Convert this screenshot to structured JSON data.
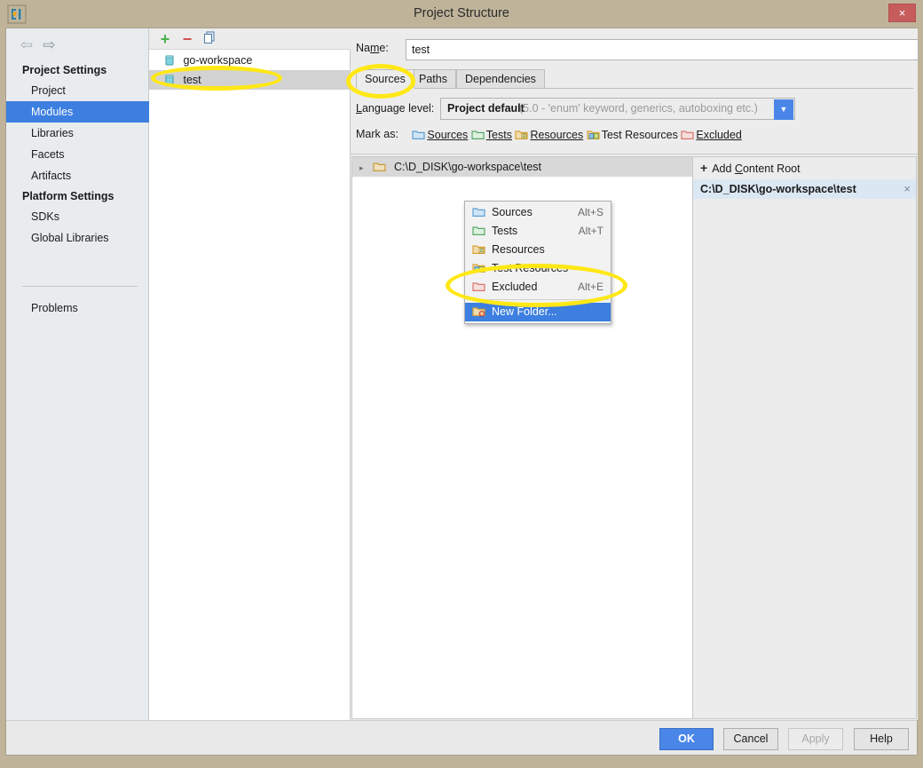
{
  "window": {
    "title": "Project Structure",
    "app_icon": "intellij-idea-logo",
    "close_label": "×"
  },
  "nav": {
    "back_icon": "arrow-left-icon",
    "forward_icon": "arrow-right-icon",
    "back_glyph": "⇦",
    "forward_glyph": "⇨"
  },
  "sidebar": {
    "groups": [
      {
        "label": "Project Settings",
        "items": [
          {
            "label": "Project",
            "selected": false
          },
          {
            "label": "Modules",
            "selected": true
          },
          {
            "label": "Libraries",
            "selected": false
          },
          {
            "label": "Facets",
            "selected": false
          },
          {
            "label": "Artifacts",
            "selected": false
          }
        ]
      },
      {
        "label": "Platform Settings",
        "items": [
          {
            "label": "SDKs",
            "selected": false
          },
          {
            "label": "Global Libraries",
            "selected": false
          }
        ]
      }
    ],
    "problems": {
      "label": "Problems",
      "selected": false
    }
  },
  "modules_panel": {
    "toolbar": {
      "add_label": "+",
      "remove_label": "−",
      "add_icon": "plus-icon",
      "remove_icon": "minus-icon",
      "copy_icon": "copy-icon"
    },
    "items": [
      {
        "label": "go-workspace",
        "selected": false,
        "icon": "module-icon"
      },
      {
        "label": "test",
        "selected": true,
        "icon": "module-icon"
      }
    ]
  },
  "editor": {
    "name_field": {
      "label_before": "Na",
      "label_mnemonic": "m",
      "label_after": "e:",
      "value": "test",
      "placeholder": ""
    },
    "tabs": [
      {
        "label": "Sources",
        "active": true
      },
      {
        "label": "Paths",
        "active": false
      },
      {
        "label": "Dependencies",
        "active": false
      }
    ],
    "language_level": {
      "label_mnemonic": "L",
      "label_after": "anguage level:",
      "value": "Project default",
      "hint": "(5.0 - 'enum' keyword, generics, autoboxing etc.)",
      "arrow_glyph": "▼",
      "arrow_icon": "chevron-down-icon"
    },
    "mark_as": {
      "label": "Mark as:",
      "options": [
        {
          "mnemonic": "S",
          "rest": "ources",
          "icon": "folder-blue-icon",
          "color": "#5e9fd4"
        },
        {
          "mnemonic": "T",
          "rest": "ests",
          "icon": "folder-green-icon",
          "color": "#59a869"
        },
        {
          "mnemonic": "R",
          "rest": "esources",
          "icon": "folder-resources-icon",
          "color": "#d9a336"
        },
        {
          "mnemonic": "",
          "rest": "Test Resources",
          "icon": "folder-test-resources-icon",
          "color": "#d9a336"
        },
        {
          "mnemonic": "E",
          "rest": "xcluded",
          "icon": "folder-red-icon",
          "color": "#d9756f"
        }
      ]
    },
    "content_root_tree": {
      "expander_glyph": "▸",
      "row_icon": "folder-tan-icon",
      "row_label": "C:\\D_DISK\\go-workspace\\test"
    },
    "content_roots": {
      "add_button": {
        "plus": "+",
        "label_before": "Add ",
        "label_mnemonic": "C",
        "label_after": "ontent Root",
        "icon": "plus-icon"
      },
      "entries": [
        {
          "path": "C:\\D_DISK\\go-workspace\\test",
          "remove_glyph": "×",
          "remove_icon": "close-icon"
        }
      ]
    }
  },
  "context_menu": {
    "items": [
      {
        "label": "Sources",
        "shortcut": "Alt+S",
        "icon": "folder-blue-icon",
        "color": "#5e9fd4",
        "highlighted": false
      },
      {
        "label": "Tests",
        "shortcut": "Alt+T",
        "icon": "folder-green-icon",
        "color": "#59a869",
        "highlighted": false
      },
      {
        "label": "Resources",
        "shortcut": "",
        "icon": "folder-resources-icon",
        "color": "#d9a336",
        "highlighted": false
      },
      {
        "label": "Test Resources",
        "shortcut": "",
        "icon": "folder-test-resources-icon",
        "color": "#d9a336",
        "highlighted": false
      },
      {
        "label": "Excluded",
        "shortcut": "Alt+E",
        "icon": "folder-red-icon",
        "color": "#d9756f",
        "highlighted": false
      },
      {
        "separator": true
      },
      {
        "label": "New Folder...",
        "shortcut": "",
        "icon": "folder-new-icon",
        "color": "#d9a336",
        "highlighted": true
      }
    ]
  },
  "footer": {
    "buttons": [
      {
        "label": "OK",
        "kind": "default"
      },
      {
        "label": "Cancel",
        "kind": "normal"
      },
      {
        "label": "Apply",
        "kind": "disabled"
      },
      {
        "label": "Help",
        "kind": "normal"
      }
    ]
  },
  "annotations": {
    "color": "#ffe816",
    "marks": [
      {
        "name": "highlight-module-test",
        "target": "test module row"
      },
      {
        "name": "highlight-sources-tab",
        "target": "Sources tab"
      },
      {
        "name": "highlight-new-folder",
        "target": "New Folder... menu item"
      }
    ]
  }
}
